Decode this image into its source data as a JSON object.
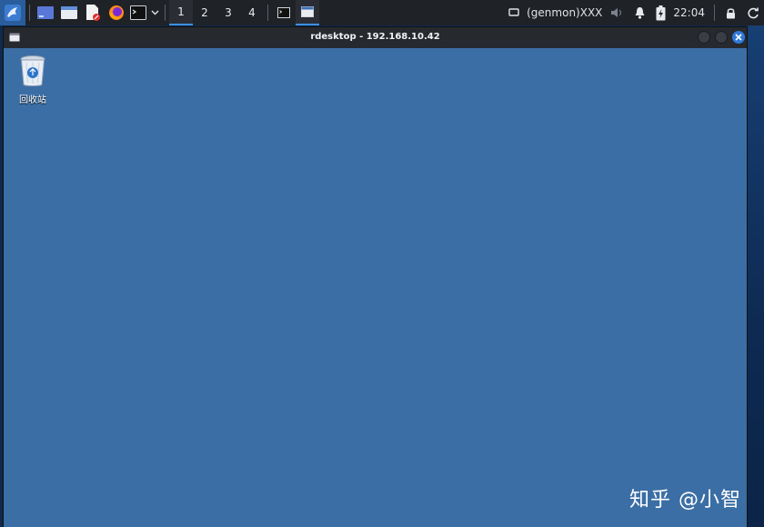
{
  "panel": {
    "workspaces": [
      "1",
      "2",
      "3",
      "4"
    ],
    "active_workspace": "1",
    "genmon_label": "(genmon)XXX",
    "clock": "22:04"
  },
  "window": {
    "title": "rdesktop - 192.168.10.42"
  },
  "desktop": {
    "recycle_bin_label": "回收站",
    "watermark": "知乎 @小智"
  },
  "colors": {
    "panel_bg": "#1f2227",
    "accent": "#3d8fe0",
    "desktop_bg": "#3a6ea5",
    "titlebar_bg": "#26292e",
    "close_button": "#2f7ad9"
  }
}
